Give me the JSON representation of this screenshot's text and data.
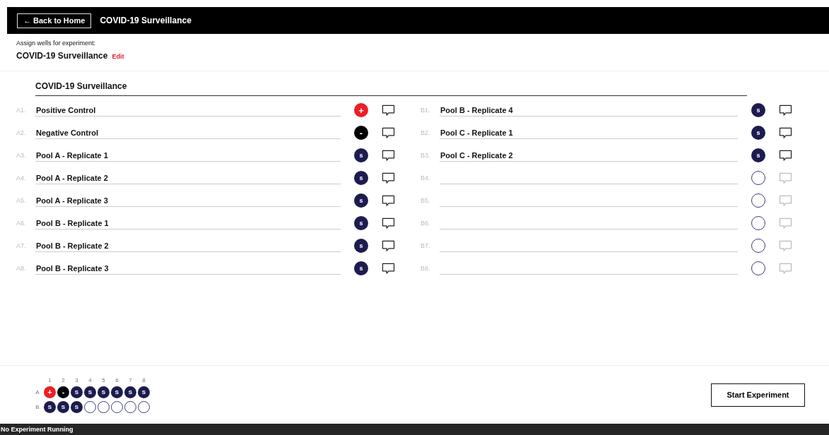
{
  "header": {
    "back_button": "← Back to Home",
    "title": "COVID-19 Surveillance"
  },
  "subheader": {
    "prompt": "Assign wells for experiment:",
    "experiment": "COVID-19 Surveillance",
    "edit_link": "Edit"
  },
  "section_title": "COVID-19 Surveillance",
  "columns": [
    {
      "wells": [
        {
          "label": "A1.",
          "name": "Positive Control",
          "kind": "positive",
          "symbol": "+"
        },
        {
          "label": "A2.",
          "name": "Negative Control",
          "kind": "negative",
          "symbol": "-"
        },
        {
          "label": "A3.",
          "name": "Pool A - Replicate 1",
          "kind": "sample",
          "symbol": "s"
        },
        {
          "label": "A4.",
          "name": "Pool A - Replicate 2",
          "kind": "sample",
          "symbol": "s"
        },
        {
          "label": "A5.",
          "name": "Pool A - Replicate 3",
          "kind": "sample",
          "symbol": "s"
        },
        {
          "label": "A6.",
          "name": "Pool B - Replicate 1",
          "kind": "sample",
          "symbol": "s"
        },
        {
          "label": "A7.",
          "name": "Pool B - Replicate 2",
          "kind": "sample",
          "symbol": "s"
        },
        {
          "label": "A8.",
          "name": "Pool B - Replicate 3",
          "kind": "sample",
          "symbol": "s"
        }
      ]
    },
    {
      "wells": [
        {
          "label": "B1.",
          "name": "Pool B - Replicate 4",
          "kind": "sample",
          "symbol": "s"
        },
        {
          "label": "B2.",
          "name": "Pool C - Replicate 1",
          "kind": "sample",
          "symbol": "s"
        },
        {
          "label": "B3.",
          "name": "Pool C - Replicate 2",
          "kind": "sample",
          "symbol": "s"
        },
        {
          "label": "B4.",
          "kind": "empty"
        },
        {
          "label": "B5.",
          "kind": "empty"
        },
        {
          "label": "B6.",
          "kind": "empty"
        },
        {
          "label": "B7.",
          "kind": "empty"
        },
        {
          "label": "B8.",
          "kind": "empty"
        }
      ]
    }
  ],
  "plate_map": {
    "column_labels": [
      "1",
      "2",
      "3",
      "4",
      "5",
      "6",
      "7",
      "8"
    ],
    "rows": [
      {
        "label": "A",
        "wells": [
          {
            "kind": "positive",
            "symbol": "+"
          },
          {
            "kind": "negative",
            "symbol": "-"
          },
          {
            "kind": "sample",
            "symbol": "S"
          },
          {
            "kind": "sample",
            "symbol": "S"
          },
          {
            "kind": "sample",
            "symbol": "S"
          },
          {
            "kind": "sample",
            "symbol": "S"
          },
          {
            "kind": "sample",
            "symbol": "S"
          },
          {
            "kind": "sample",
            "symbol": "S"
          }
        ]
      },
      {
        "label": "B",
        "wells": [
          {
            "kind": "sample",
            "symbol": "S"
          },
          {
            "kind": "sample",
            "symbol": "S"
          },
          {
            "kind": "sample",
            "symbol": "S"
          },
          {
            "kind": "empty"
          },
          {
            "kind": "empty"
          },
          {
            "kind": "empty"
          },
          {
            "kind": "empty"
          },
          {
            "kind": "empty"
          }
        ]
      }
    ]
  },
  "start_button": "Start Experiment",
  "status_bar": "No Experiment Running"
}
